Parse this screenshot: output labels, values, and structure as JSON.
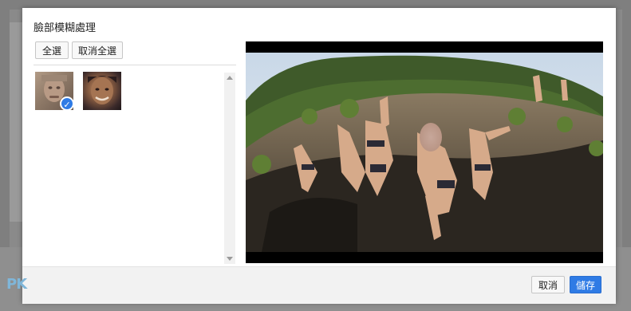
{
  "dialog": {
    "title": "臉部模糊處理",
    "select_all_label": "全選",
    "deselect_all_label": "取消全選",
    "faces": [
      {
        "name": "face-thumb-1",
        "selected": true
      },
      {
        "name": "face-thumb-2",
        "selected": false
      }
    ],
    "check_glyph": "✓",
    "cancel_label": "取消",
    "save_label": "儲存"
  },
  "watermark": {
    "text": "PK"
  },
  "colors": {
    "accent": "#2f7be5",
    "overlay": "#7f7f7f",
    "footer": "#f2f2f2"
  }
}
